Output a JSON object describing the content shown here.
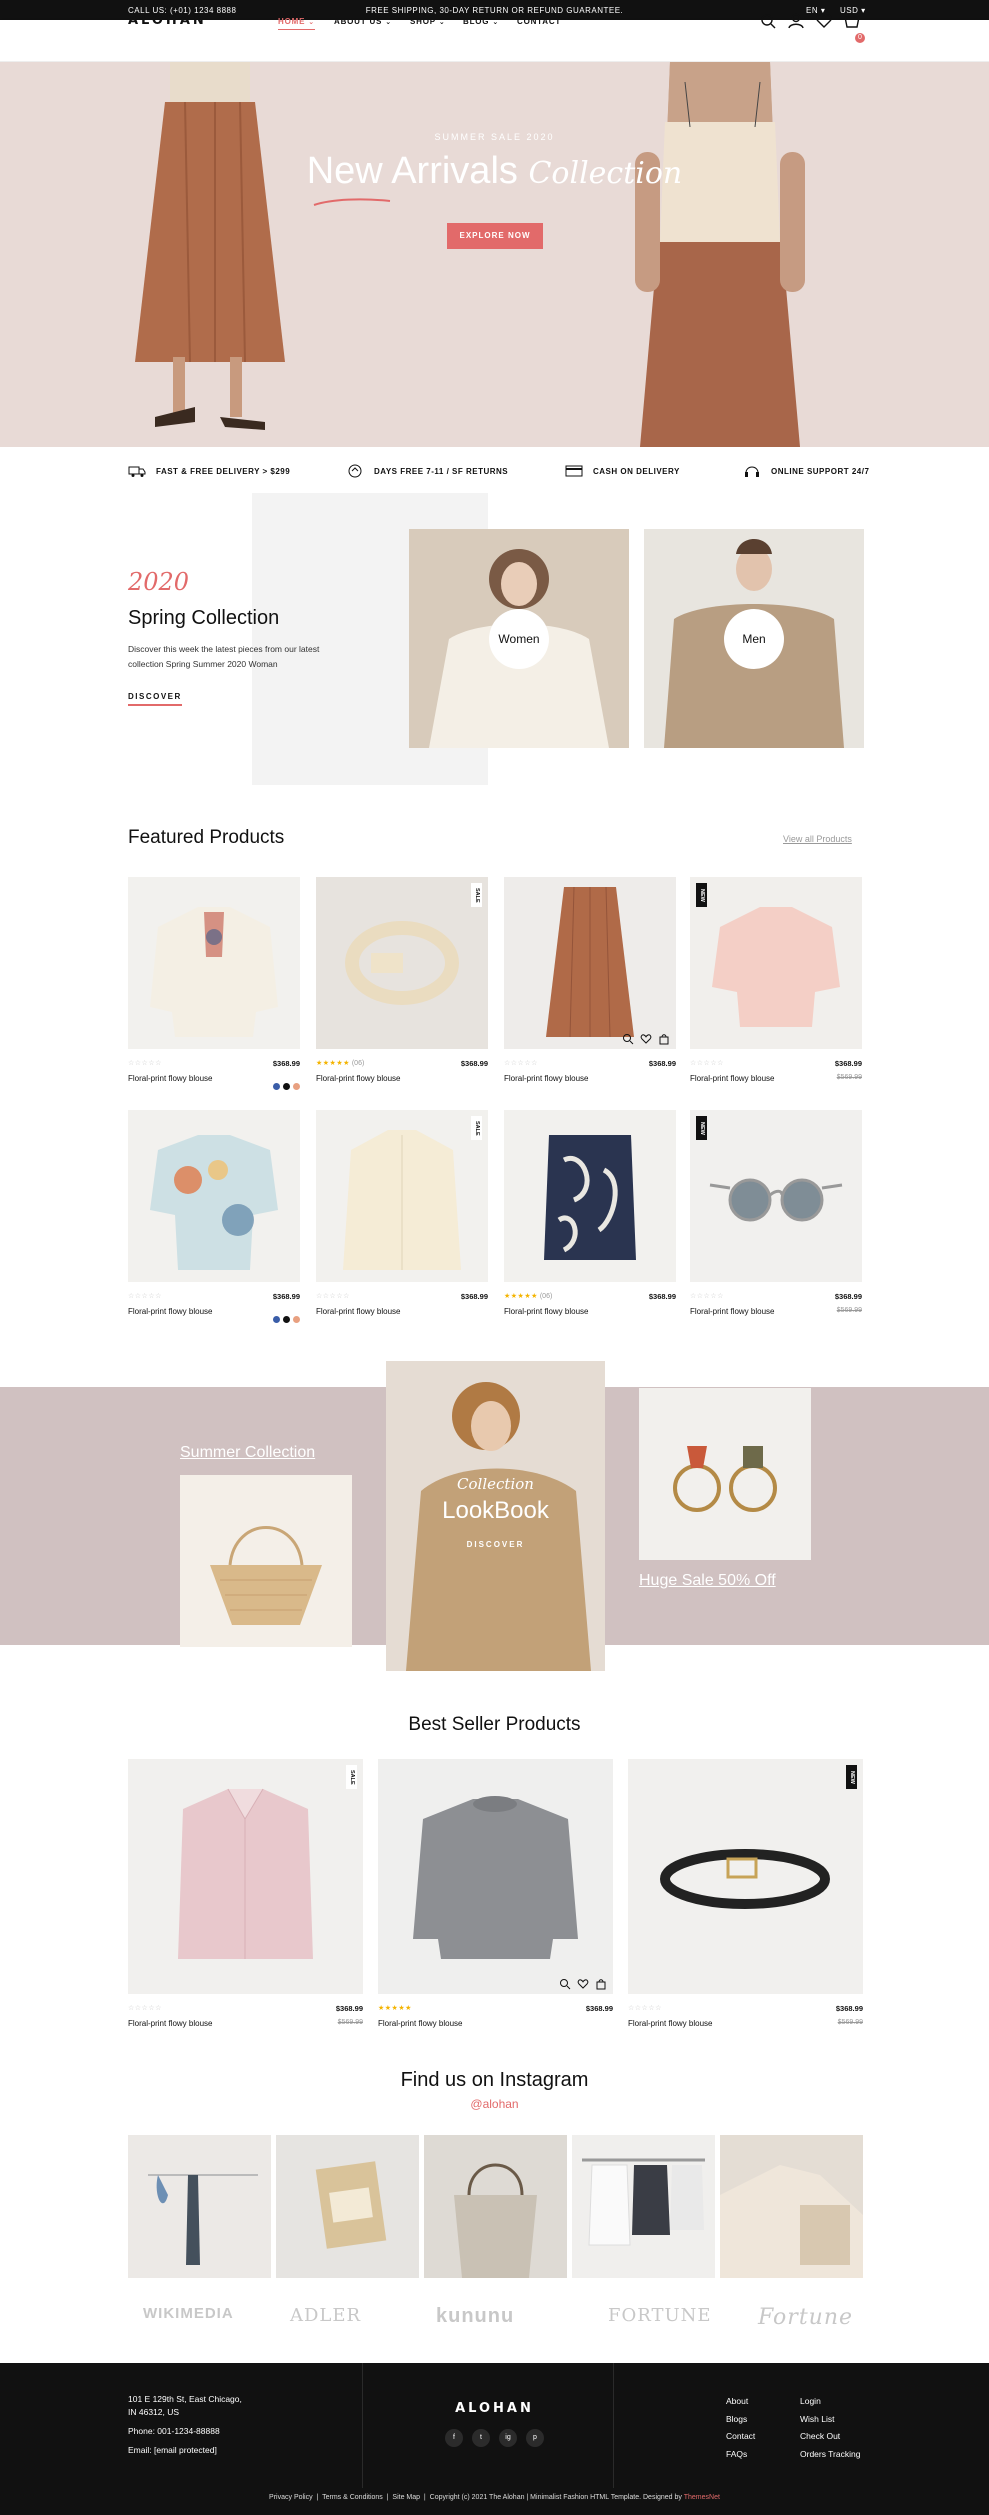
{
  "topbar": {
    "call": "CALL US: (+01) 1234 8888",
    "shipping": "FREE SHIPPING, 30-DAY RETURN OR REFUND GUARANTEE.",
    "lang": "EN",
    "currency": "USD"
  },
  "header": {
    "logo": "ALOHAN",
    "nav": [
      "HOME",
      "ABOUT US",
      "SHOP",
      "BLOG",
      "CONTACT"
    ],
    "cart_count": "0",
    "icons": [
      "search-icon",
      "user-icon",
      "heart-icon",
      "cart-icon"
    ]
  },
  "hero": {
    "subtitle": "SUMMER SALE 2020",
    "title_main": "New Arrivals",
    "title_script": "Collection",
    "button": "EXPLORE NOW"
  },
  "features": [
    {
      "icon": "truck-icon",
      "label": "FAST & FREE DELIVERY > $299"
    },
    {
      "icon": "return-icon",
      "label": "DAYS FREE 7-11 / SF RETURNS"
    },
    {
      "icon": "card-icon",
      "label": "CASH ON DELIVERY"
    },
    {
      "icon": "support-icon",
      "label": "ONLINE SUPPORT 24/7"
    }
  ],
  "spring": {
    "year": "2020",
    "title": "Spring Collection",
    "desc": "Discover this week the latest pieces from our latest collection Spring Summer 2020 Woman",
    "link": "DISCOVER",
    "categories": [
      "Women",
      "Men"
    ]
  },
  "featured": {
    "title": "Featured Products",
    "view_all": "View all Products",
    "products": [
      {
        "name": "Floral-print flowy blouse",
        "price": "$368.99",
        "old": "",
        "stars": "☆☆☆☆☆",
        "reviews": "",
        "tag": ""
      },
      {
        "name": "Floral-print flowy blouse",
        "price": "$368.99",
        "old": "",
        "stars": "★★★★★",
        "reviews": "(06)",
        "tag": "SALE"
      },
      {
        "name": "Floral-print flowy blouse",
        "price": "$368.99",
        "old": "",
        "stars": "☆☆☆☆☆",
        "reviews": "",
        "tag": ""
      },
      {
        "name": "Floral-print flowy blouse",
        "price": "$368.99",
        "old": "$569.99",
        "stars": "☆☆☆☆☆",
        "reviews": "",
        "tag": "NEW"
      },
      {
        "name": "Floral-print flowy blouse",
        "price": "$368.99",
        "old": "",
        "stars": "☆☆☆☆☆",
        "reviews": "",
        "tag": ""
      },
      {
        "name": "Floral-print flowy blouse",
        "price": "$368.99",
        "old": "",
        "stars": "☆☆☆☆☆",
        "reviews": "",
        "tag": "SALE"
      },
      {
        "name": "Floral-print flowy blouse",
        "price": "$368.99",
        "old": "",
        "stars": "★★★★★",
        "reviews": "(06)",
        "tag": ""
      },
      {
        "name": "Floral-print flowy blouse",
        "price": "$368.99",
        "old": "$569.99",
        "stars": "☆☆☆☆☆",
        "reviews": "",
        "tag": "NEW"
      }
    ]
  },
  "lookbook": {
    "summer": "Summer Collection",
    "script": "Collection",
    "title": "LookBook",
    "discover": "DISCOVER",
    "sale": "Huge Sale 50% Off"
  },
  "bestseller": {
    "title": "Best Seller Products",
    "products": [
      {
        "name": "Floral-print flowy blouse",
        "price": "$368.99",
        "old": "$569.99",
        "stars": "☆☆☆☆☆",
        "tag": "SALE"
      },
      {
        "name": "Floral-print flowy blouse",
        "price": "$368.99",
        "old": "",
        "stars": "★★★★★",
        "tag": ""
      },
      {
        "name": "Floral-print flowy blouse",
        "price": "$368.99",
        "old": "$569.99",
        "stars": "☆☆☆☆☆",
        "tag": "NEW"
      }
    ]
  },
  "instagram": {
    "title": "Find us on Instagram",
    "handle": "@alohan"
  },
  "brands": [
    "WIKIMEDIA",
    "ADLER",
    "kununu",
    "FORTUNE",
    "Fortune"
  ],
  "footer": {
    "address1": "101 E 129th St, East Chicago,",
    "address2": "IN 46312, US",
    "phone": "Phone: 001-1234-88888",
    "email": "Email: [email protected]",
    "logo": "ALOHAN",
    "social": [
      "f",
      "t",
      "ig",
      "p"
    ],
    "links1": [
      "About",
      "Blogs",
      "Contact",
      "FAQs"
    ],
    "links2": [
      "Login",
      "Wish List",
      "Check Out",
      "Orders Tracking"
    ],
    "bottom_links": [
      "Privacy Policy",
      "Terms & Conditions",
      "Site Map"
    ],
    "copyright": "Copyright (c) 2021 The Alohan | Minimalist Fashion HTML Template. Designed by",
    "designer": "ThemesNet"
  },
  "colors": {
    "accent": "#e26a6a",
    "hero_bg": "#e8dad6",
    "band_bg": "#d0c1c1",
    "dark": "#111111"
  }
}
